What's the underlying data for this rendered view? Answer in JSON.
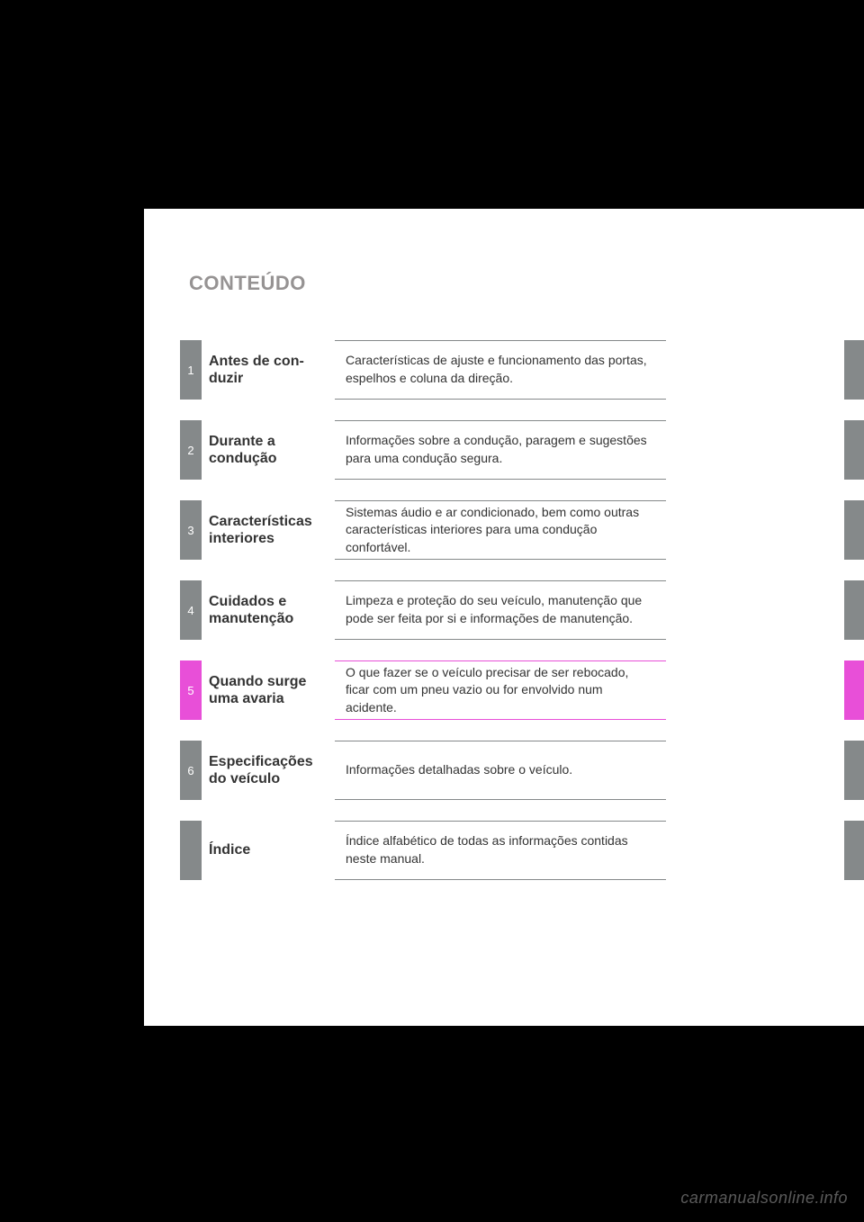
{
  "header": {
    "title": "CONTEÚDO"
  },
  "toc": [
    {
      "num": "1",
      "title": "Antes de con-\nduzir",
      "desc": "Características de ajuste e funcionamento das portas, espelhos e coluna da direção.",
      "highlight": false
    },
    {
      "num": "2",
      "title": "Durante a condução",
      "desc": "Informações sobre a condução, paragem e sugestões para uma condução segura.",
      "highlight": false
    },
    {
      "num": "3",
      "title": "Características interiores",
      "desc": "Sistemas áudio e ar condicionado, bem como outras características interiores para uma condução confortável.",
      "highlight": false
    },
    {
      "num": "4",
      "title": "Cuidados e manutenção",
      "desc": "Limpeza e proteção do seu veículo, manutenção que pode ser feita por si e informações de manutenção.",
      "highlight": false
    },
    {
      "num": "5",
      "title": "Quando surge uma avaria",
      "desc": "O que fazer se o veículo precisar de ser rebocado, ficar com um pneu vazio ou for envolvido num acidente.",
      "highlight": true
    },
    {
      "num": "6",
      "title": "Especificações do veículo",
      "desc": "Informações detalhadas sobre o veículo.",
      "highlight": false
    },
    {
      "num": "",
      "title": "Índice",
      "desc": "Índice alfabético de todas as informações contidas neste manual.",
      "highlight": false
    }
  ],
  "footer": {
    "watermark": "carmanualsonline.info"
  }
}
